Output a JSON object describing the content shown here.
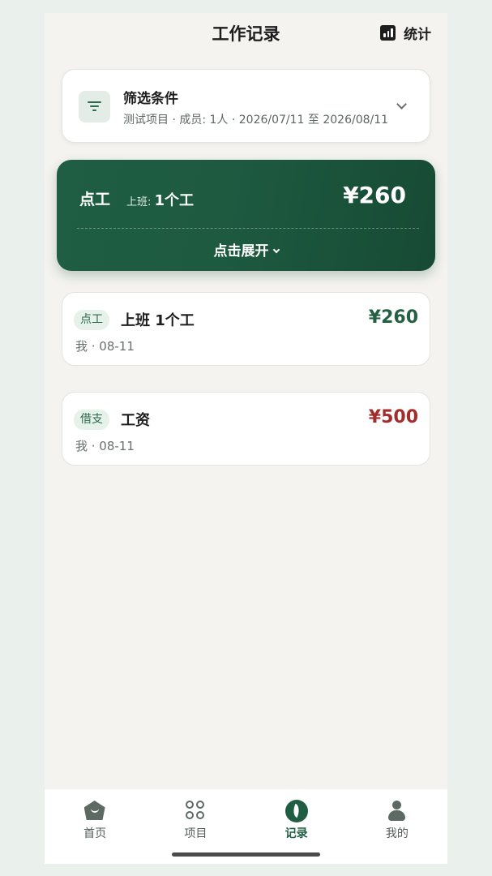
{
  "header": {
    "title": "工作记录",
    "stats_label": "统计"
  },
  "filter": {
    "title": "筛选条件",
    "summary": "测试项目 · 成员: 1人 · 2026/07/11 至 2026/08/11"
  },
  "summary_card": {
    "type": "点工",
    "detail_prefix": "上班:",
    "detail_value": "1个工",
    "amount": "¥260",
    "expand_label": "点击展开"
  },
  "records": [
    {
      "tag": "点工",
      "title": "上班 1个工",
      "meta": "我 · 08-11",
      "amount": "¥260",
      "amount_color": "#246144"
    },
    {
      "tag": "借支",
      "title": "工资",
      "meta": "我 · 08-11",
      "amount": "¥500",
      "amount_color": "#a22d2b"
    }
  ],
  "tabbar": [
    {
      "label": "首页",
      "icon": "home-icon",
      "active": false
    },
    {
      "label": "项目",
      "icon": "grid-icon",
      "active": false
    },
    {
      "label": "记录",
      "icon": "leaf-icon",
      "active": true
    },
    {
      "label": "我的",
      "icon": "person-icon",
      "active": false
    }
  ],
  "colors": {
    "brand": "#1f5e43",
    "expense": "#a22d2b",
    "background": "#f4f3ef"
  }
}
